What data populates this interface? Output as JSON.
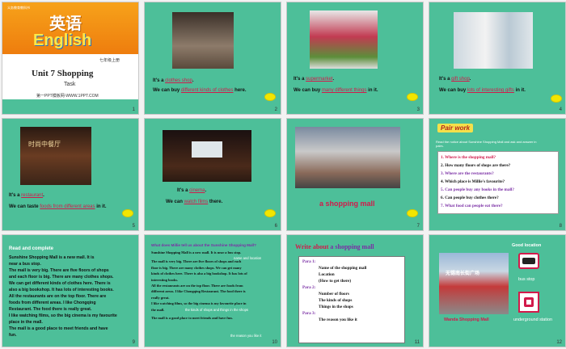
{
  "slides": {
    "s1": {
      "logo_text": "义务教育教科书",
      "title_cn": "英语",
      "title_en": "English",
      "grade": "七年级上册",
      "unit": "Unit 7  Shopping",
      "sub": "Task",
      "site": "第一PPT模板网-WWW.1PPT.COM",
      "num": "1"
    },
    "s2": {
      "l1a": "It's a",
      "l1b": "clothes shop",
      "l1c": ".",
      "l2a": "We can buy",
      "l2b": "different kinds of clothes",
      "l2c": "here.",
      "num": "2"
    },
    "s3": {
      "l1a": "It's a",
      "l1b": "supermarket",
      "l1c": ".",
      "l2a": "We can buy",
      "l2b": "many different things",
      "l2c": "in it.",
      "num": "3"
    },
    "s4": {
      "l1a": "It's a",
      "l1b": "gift shop",
      "l1c": ".",
      "l2a": "We can buy",
      "l2b": "lots of interesting gifts",
      "l2c": "in it.",
      "num": "4"
    },
    "s5": {
      "sign": "时尚中餐厅",
      "l1a": "It's a",
      "l1b": "restaurant",
      "l1c": ".",
      "l2a": "We can taste",
      "l2b": "foods from different areas",
      "l2c": "in it.",
      "num": "5"
    },
    "s6": {
      "l1a": "It's a",
      "l1b": "cinema",
      "l1c": ".",
      "l2a": "We can",
      "l2b": "watch films",
      "l2c": "there.",
      "num": "6"
    },
    "s7": {
      "caption": "a shopping mall",
      "num": "7"
    },
    "s8": {
      "badge": "Pair work",
      "intro": "Read the notice about Sunshine Shopping Mall and ask and answer in pairs.",
      "qs": [
        "1. Where is the shopping mall?",
        "2. How many floors of shops are there?",
        "3. Where are the restaurants?",
        "4. Which place is Millie's favourite?",
        "5. Can people buy any books in the mall?",
        "6. Can people buy clothes there?",
        "7. What food can people eat there?"
      ],
      "num": "8"
    },
    "s9": {
      "heading": "Read and complete",
      "lines": [
        "Sunshine Shopping Mall is a new mall. It is",
        "near a bus stop.",
        "The mall is very big. There are five floors of shops",
        "and each floor is big. There are many clothes shops.",
        "We can get different kinds of clothes here. There is",
        "also a big bookshop. It has lots of interesting books.",
        "All the restaurants are on the top floor. There are",
        "foods from different areas. I like Chongqing",
        "Restaurant. The food there is really great.",
        "I like watching films, so the big cinema is my favourite",
        "place in the mall.",
        "The mall is a good place to meet friends and have",
        "fun."
      ],
      "num": "9"
    },
    "s10": {
      "heading": "What does Millie tell us about the Sunshine Shopping Mall?",
      "note1": "name and location",
      "lines": [
        "Sunshine Shopping Mall is a new mall. It is near a bus stop.",
        "The mall is very big. There are five floors of shops and each",
        "floor is big. There are many clothes shops. We can get many",
        "kinds of clothes here. There is also a big bookshop. It has lots of",
        "interesting books.",
        "All the restaurants are on the top floor. There are foods from",
        "different areas. I like Chongqing Restaurant. The food there is",
        "really great.",
        "I like watching films, so the big cinema is my favourite place in",
        "the mall.",
        "The mall is a good place to meet friends and have fun."
      ],
      "note2": "the kinds of shops and things in the shops",
      "note3": "the reason you like it",
      "num": "10"
    },
    "s11": {
      "title_a": "Write about",
      "title_b": "a shopping mall",
      "p1": "Para 1:",
      "p1_items": [
        "Name of the shopping mall",
        "Location",
        "(How to get there)"
      ],
      "p2": "Para 2:",
      "p2_items": [
        "Number of floors",
        "The kinds of shops",
        "Things in the shops"
      ],
      "p3": "Para 3:",
      "p3_items": [
        "The reason you like it"
      ],
      "num": "11"
    },
    "s12": {
      "good_location": "Good location",
      "sign": "无锡南长街广场",
      "caption": "Wanda Shopping Mall",
      "bus": "bus stop",
      "underground": "underground station",
      "num": "12"
    }
  },
  "colors": {
    "slide_bg": "#4dbf99",
    "accent_red": "#d21a4b",
    "title_orange": "#f0901e",
    "purple": "#7a2ea5"
  }
}
